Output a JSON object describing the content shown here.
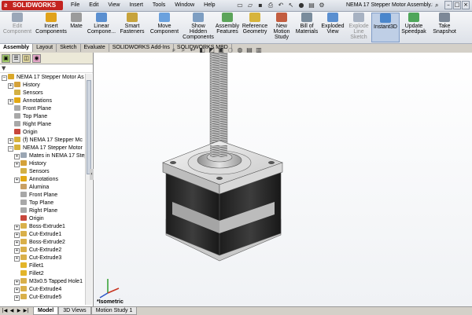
{
  "app": {
    "logo": "SOLIDWORKS",
    "document_title": "NEMA 17 Stepper Motor Assembly.S..."
  },
  "menu": [
    "File",
    "Edit",
    "View",
    "Insert",
    "Tools",
    "Window",
    "Help"
  ],
  "ribbon": [
    {
      "label": "Edit\nComponent",
      "disabled": true,
      "color": "#9aa7b8"
    },
    {
      "label": "Insert\nComponents",
      "disabled": false,
      "color": "#e0a21b"
    },
    {
      "label": "Mate",
      "disabled": false,
      "color": "#9b9b9b"
    },
    {
      "label": "Linear\nCompone...",
      "disabled": false,
      "color": "#5a8fd0"
    },
    {
      "label": "Smart\nFasteners",
      "disabled": false,
      "color": "#c7a33c"
    },
    {
      "label": "Move\nComponent",
      "disabled": false,
      "color": "#6aa1de"
    },
    {
      "label": "Show\nHidden\nComponents",
      "disabled": false,
      "color": "#7d9ec2"
    },
    {
      "label": "Assembly\nFeatures",
      "disabled": false,
      "color": "#5ca45a"
    },
    {
      "label": "Reference\nGeometry",
      "disabled": false,
      "color": "#d7b43c"
    },
    {
      "label": "New\nMotion\nStudy",
      "disabled": false,
      "color": "#c35d40"
    },
    {
      "label": "Bill of\nMaterials",
      "disabled": false,
      "color": "#7a8c9c"
    },
    {
      "label": "Exploded\nView",
      "disabled": false,
      "color": "#5a8fd0"
    },
    {
      "label": "Explode\nLine\nSketch",
      "disabled": true,
      "color": "#a7b2c2"
    },
    {
      "label": "Instant3D",
      "disabled": false,
      "active": true,
      "color": "#4a86cc"
    },
    {
      "label": "Update\nSpeedpak",
      "disabled": false,
      "color": "#4fa65a"
    },
    {
      "label": "Take\nSnapshot",
      "disabled": false,
      "color": "#7c8897"
    }
  ],
  "tabs": [
    "Assembly",
    "Layout",
    "Sketch",
    "Evaluate",
    "SOLIDWORKS Add-Ins",
    "SOLIDWORKS MBD"
  ],
  "active_tab": "Assembly",
  "tree": [
    {
      "label": "NEMA 17 Stepper Motor As",
      "indent": 0,
      "color": "#d9a72a",
      "expand": "−"
    },
    {
      "label": "History",
      "indent": 1,
      "color": "#d4a23a",
      "expand": "+"
    },
    {
      "label": "Sensors",
      "indent": 1,
      "color": "#d3b044",
      "expand": ""
    },
    {
      "label": "Annotations",
      "indent": 1,
      "color": "#e2a814",
      "expand": "+"
    },
    {
      "label": "Front Plane",
      "indent": 1,
      "color": "#a8a8a8",
      "expand": ""
    },
    {
      "label": "Top Plane",
      "indent": 1,
      "color": "#a8a8a8",
      "expand": ""
    },
    {
      "label": "Right Plane",
      "indent": 1,
      "color": "#a8a8a8",
      "expand": ""
    },
    {
      "label": "Origin",
      "indent": 1,
      "color": "#c8473c",
      "expand": ""
    },
    {
      "label": "(f) NEMA 17 Stepper Mc",
      "indent": 1,
      "color": "#d6b23c",
      "expand": "+"
    },
    {
      "label": "NEMA 17 Stepper Motor",
      "indent": 1,
      "color": "#d6b23c",
      "expand": "−"
    },
    {
      "label": "Mates in NEMA 17 Step",
      "indent": 2,
      "color": "#9aa6b4",
      "expand": "+"
    },
    {
      "label": "History",
      "indent": 2,
      "color": "#d4a23a",
      "expand": "+"
    },
    {
      "label": "Sensors",
      "indent": 2,
      "color": "#d3b044",
      "expand": ""
    },
    {
      "label": "Annotations",
      "indent": 2,
      "color": "#e2a814",
      "expand": "+"
    },
    {
      "label": "Alumina",
      "indent": 2,
      "color": "#c9a064",
      "expand": ""
    },
    {
      "label": "Front Plane",
      "indent": 2,
      "color": "#a8a8a8",
      "expand": ""
    },
    {
      "label": "Top Plane",
      "indent": 2,
      "color": "#a8a8a8",
      "expand": ""
    },
    {
      "label": "Right Plane",
      "indent": 2,
      "color": "#a8a8a8",
      "expand": ""
    },
    {
      "label": "Origin",
      "indent": 2,
      "color": "#c8473c",
      "expand": ""
    },
    {
      "label": "Boss-Extrude1",
      "indent": 2,
      "color": "#d9b04a",
      "expand": "+"
    },
    {
      "label": "Cut-Extrude1",
      "indent": 2,
      "color": "#d9b04a",
      "expand": "+"
    },
    {
      "label": "Boss-Extrude2",
      "indent": 2,
      "color": "#d9b04a",
      "expand": "+"
    },
    {
      "label": "Cut-Extrude2",
      "indent": 2,
      "color": "#d9b04a",
      "expand": "+"
    },
    {
      "label": "Cut-Extrude3",
      "indent": 2,
      "color": "#d9b04a",
      "expand": "+"
    },
    {
      "label": "Fillet1",
      "indent": 2,
      "color": "#e3b52a",
      "expand": ""
    },
    {
      "label": "Fillet2",
      "indent": 2,
      "color": "#e3b52a",
      "expand": ""
    },
    {
      "label": "M3x0.5 Tapped Hole1",
      "indent": 2,
      "color": "#d9b04a",
      "expand": "+"
    },
    {
      "label": "Cut-Extrude4",
      "indent": 2,
      "color": "#d9b04a",
      "expand": "+"
    },
    {
      "label": "Cut-Extrude5",
      "indent": 2,
      "color": "#d9b04a",
      "expand": "+"
    }
  ],
  "viewport": {
    "label": "*Isometric"
  },
  "bottom_tabs": [
    "Model",
    "3D Views",
    "Motion Study 1"
  ],
  "active_bottom_tab": "Model"
}
